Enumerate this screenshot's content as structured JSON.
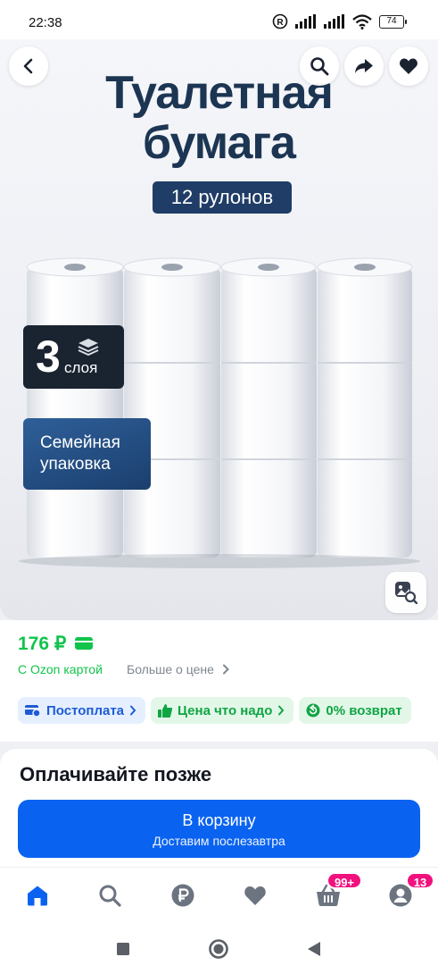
{
  "status_bar": {
    "time": "22:38",
    "battery": "74"
  },
  "gallery": {
    "headline_line1": "Туалетная",
    "headline_line2": "бумага",
    "rolls_label": "12 рулонов",
    "ply_number": "3",
    "ply_word": "слоя",
    "family_line1": "Семейная",
    "family_line2": "упаковка",
    "icons": {
      "back": "arrow-left-icon",
      "search": "search-icon",
      "share": "share-icon",
      "favorite": "heart-icon",
      "zoom": "image-search-icon"
    }
  },
  "price": {
    "value": "176 ₽",
    "ozon_card_label": "С Ozon картой",
    "more_label": "Больше о цене"
  },
  "chips": [
    {
      "label": "Постоплата",
      "color": "#1d5bd6"
    },
    {
      "label": "Цена что надо",
      "color": "#10a543"
    },
    {
      "label": "0% возврат",
      "color": "#10a543"
    }
  ],
  "pay_later": {
    "title": "Оплачивайте позже",
    "cart_button": "В корзину",
    "cart_sub": "Доставим послезавтра"
  },
  "bottom_nav": {
    "items": [
      "home-icon",
      "search-icon",
      "ruble-icon",
      "heart-icon",
      "basket-icon",
      "profile-icon"
    ],
    "cart_badge": "99+",
    "profile_badge": "13"
  },
  "colors": {
    "brand_blue": "#0a63f0",
    "price_green": "#10c44c",
    "badge_pink": "#f1117e"
  }
}
